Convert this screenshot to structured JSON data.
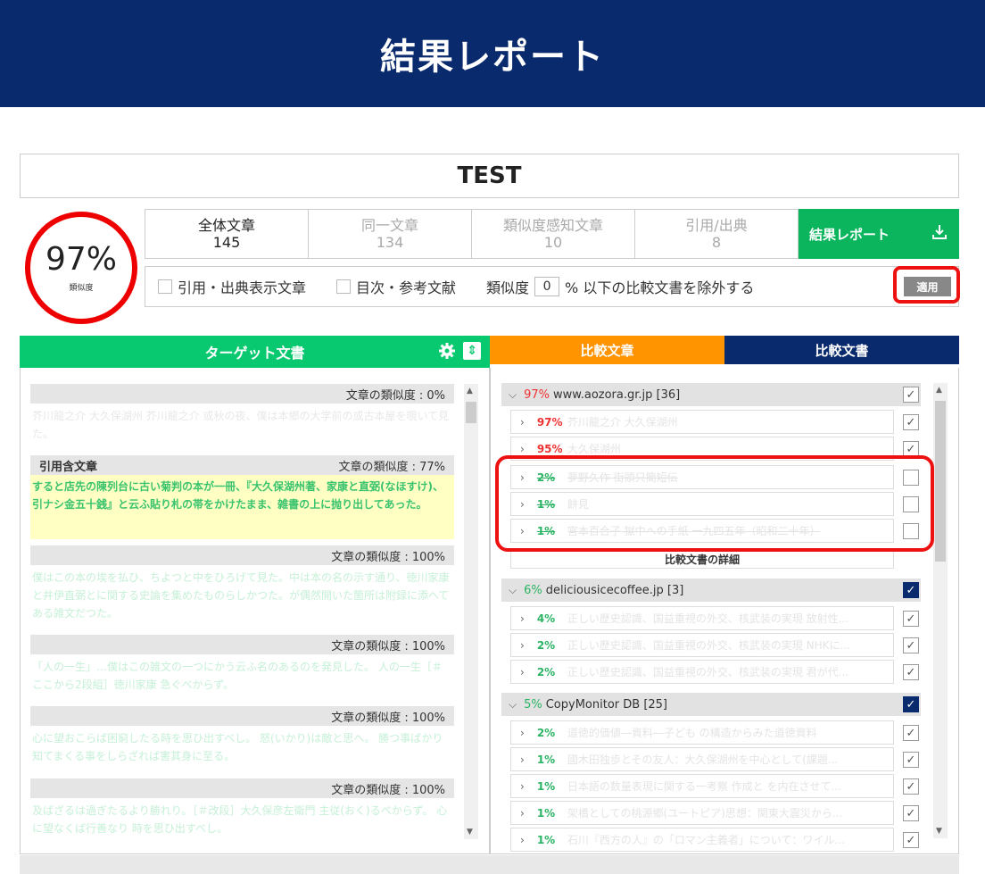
{
  "header": {
    "title": "結果レポート"
  },
  "doc_title": "TEST",
  "score": {
    "percent": "97%",
    "label": "類似度"
  },
  "stats": [
    {
      "label": "全体文章",
      "value": "145"
    },
    {
      "label": "同一文章",
      "value": "134"
    },
    {
      "label": "類似度感知文章",
      "value": "10"
    },
    {
      "label": "引用/出典",
      "value": "8"
    }
  ],
  "report_button": {
    "label": "結果レポート",
    "icon": "download-icon"
  },
  "filter": {
    "citation_label": "引用・出典表示文章",
    "toc_label": "目次・参考文献",
    "similarity_prefix": "類似度",
    "similarity_value": "0",
    "similarity_suffix": "% 以下の比較文書を除外する",
    "apply_label": "適用"
  },
  "target": {
    "title": "ターゲット文書",
    "blocks": [
      {
        "label": "",
        "similarity": "文章の類似度 : 0%",
        "text": "芥川龍之介 大久保湖州 芥川龍之介 或秋の夜、僕は本郷の大学前の或古本屋を覗いて見た。"
      },
      {
        "label": "引用含文章",
        "similarity": "文章の類似度 : 77%",
        "text": "すると店先の陳列台に古い菊判の本が一冊、『大久保湖州著、家康と直弼(なほすけ)、引ナシ金五十銭』と云ふ貼り札の帯をかけたまま、雑書の上に抛り出してあった。"
      },
      {
        "label": "",
        "similarity": "文章の類似度 : 100%",
        "text": "僕はこの本の埃を払ひ、ちよつと中をひろげて見た。中は本の名の示す通り、徳川家康と井伊直弼とに関する史論を集めたものらしかつた。が偶然開いた箇所は附録に添へてある雑文だつた。"
      },
      {
        "label": "",
        "similarity": "文章の類似度 : 100%",
        "text": "「人の一生」…僕はこの雑文の一つにかう云ふ名のあるのを発見した。 人の一生［＃ここから2段組］徳川家康 急ぐべからず。"
      },
      {
        "label": "",
        "similarity": "文章の類似度 : 100%",
        "text": "心に望おこらば困窮したる時を思ひ出すべし。 怒(いかり)は敵と思へ。 勝つ事ばかり知てまくる事をしらざれば害其身に至る。"
      },
      {
        "label": "",
        "similarity": "文章の類似度 : 100%",
        "text": "及ばざるは過ぎたるより勝れり。［＃改段］大久保彦左衛門 主従(おく)るべからず。 心に望なくば行善なり 時を思ひ出すべし。"
      }
    ]
  },
  "compare_tabs": {
    "sentence": "比較文章",
    "document": "比較文書"
  },
  "sources": [
    {
      "percent": "97%",
      "name": "www.aozora.gr.jp [36]",
      "items": [
        {
          "percent": "97%",
          "title": "芥川龍之介 大久保湖州"
        },
        {
          "percent": "95%",
          "title": "大久保湖州"
        },
        {
          "percent": "2%",
          "title": "夢野久作 街頭只簡短伝"
        },
        {
          "percent": "1%",
          "title": "餅見"
        },
        {
          "percent": "1%",
          "title": "宮本百合子 獄中への手紙 一九四五年（昭和二十年）"
        }
      ],
      "detail": "比較文書の詳細"
    },
    {
      "percent": "6%",
      "name": "deliciousicecoffee.jp [3]",
      "items": [
        {
          "percent": "4%",
          "title": "正しい歴史認識、国益重視の外交、核武装の実現 放射性..."
        },
        {
          "percent": "2%",
          "title": "正しい歴史認識、国益重視の外交、核武装の実現 NHKに..."
        },
        {
          "percent": "2%",
          "title": "正しい歴史認識、国益重視の外交、核武装の実現 君が代..."
        }
      ]
    },
    {
      "percent": "5%",
      "name": "CopyMonitor DB [25]",
      "items": [
        {
          "percent": "2%",
          "title": "道徳的価値―資料―子ども の構造からみた道徳資料"
        },
        {
          "percent": "1%",
          "title": "國木田独歩とその友人：大久保湖州を中心として(課題..."
        },
        {
          "percent": "1%",
          "title": "日本語の数量表現に関する一考察 作成と を内在させて..."
        },
        {
          "percent": "1%",
          "title": "架橋としての桃源郷(ユートピア)思想：関東大震災から..."
        },
        {
          "percent": "1%",
          "title": "石川『西方の人』の「ロマン主義者」について：ワイル..."
        }
      ]
    }
  ],
  "colors": {
    "header": "#0a2a6e",
    "green": "#08c96f",
    "orange": "#ff9300",
    "highlight": "#e11111"
  }
}
